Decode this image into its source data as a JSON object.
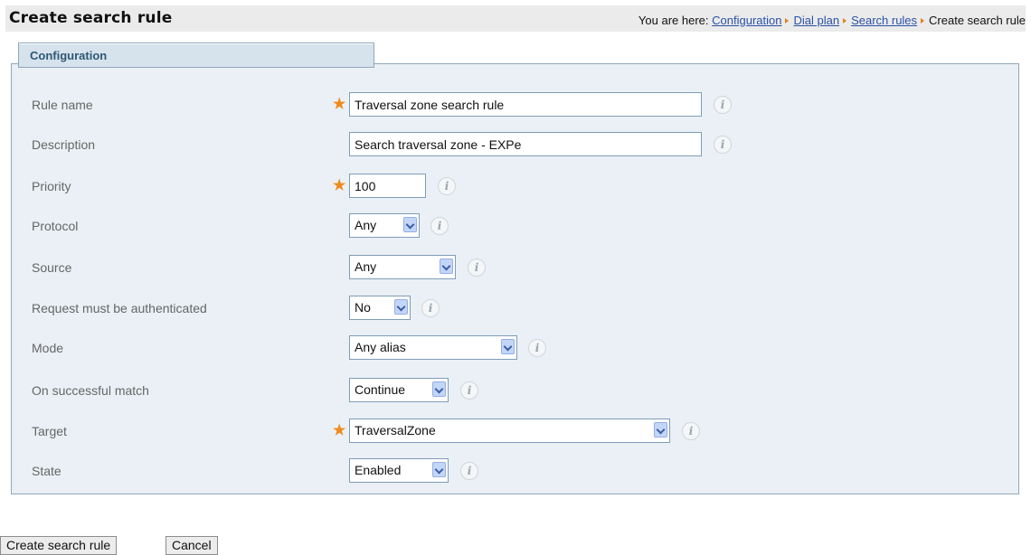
{
  "header": {
    "title": "Create search rule",
    "breadcrumb_prefix": "You are here:",
    "breadcrumb": [
      "Configuration",
      "Dial plan",
      "Search rules"
    ],
    "breadcrumb_current": "Create search rule"
  },
  "panel": {
    "title": "Configuration"
  },
  "form": {
    "rule_name": {
      "label": "Rule name",
      "value": "Traversal zone search rule",
      "info": "i"
    },
    "description": {
      "label": "Description",
      "value": "Search traversal zone - EXPe",
      "info": "i"
    },
    "priority": {
      "label": "Priority",
      "value": "100",
      "info": "i"
    },
    "protocol": {
      "label": "Protocol",
      "value": "Any",
      "info": "i"
    },
    "source": {
      "label": "Source",
      "value": "Any",
      "info": "i"
    },
    "request_auth": {
      "label": "Request must be authenticated",
      "value": "No",
      "info": "i"
    },
    "mode": {
      "label": "Mode",
      "value": "Any alias",
      "info": "i"
    },
    "on_match": {
      "label": "On successful match",
      "value": "Continue",
      "info": "i"
    },
    "target": {
      "label": "Target",
      "value": "TraversalZone",
      "info": "i"
    },
    "state": {
      "label": "State",
      "value": "Enabled",
      "info": "i"
    },
    "required_marker": "★"
  },
  "buttons": {
    "create": "Create search rule",
    "cancel": "Cancel"
  },
  "colors": {
    "accent_orange": "#f08a1c",
    "link_blue": "#2a52a8",
    "panel_bg": "#eaf0f5"
  }
}
